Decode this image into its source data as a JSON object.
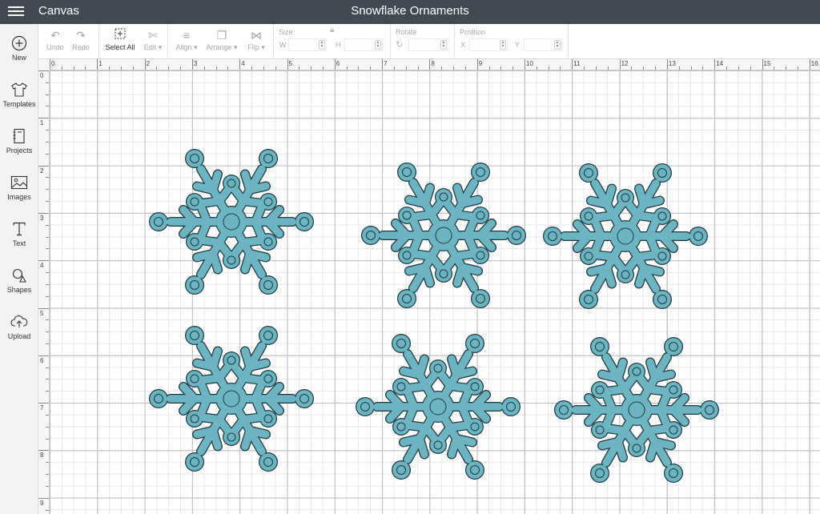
{
  "header": {
    "app_name": "Canvas",
    "project_title": "Snowflake Ornaments"
  },
  "toolbar": {
    "undo": "Undo",
    "redo": "Redo",
    "select_all": "Select All",
    "edit": "Edit",
    "align": "Align",
    "arrange": "Arrange",
    "flip": "Flip",
    "size_label": "Size",
    "w_label": "W",
    "h_label": "H",
    "rotate_label": "Rotate",
    "position_label": "Position",
    "x_label": "X",
    "y_label": "Y"
  },
  "sidebar": {
    "items": [
      {
        "label": "New",
        "icon": "plus-circle-icon"
      },
      {
        "label": "Templates",
        "icon": "tshirt-icon"
      },
      {
        "label": "Projects",
        "icon": "notebook-icon"
      },
      {
        "label": "Images",
        "icon": "image-icon"
      },
      {
        "label": "Text",
        "icon": "text-icon"
      },
      {
        "label": "Shapes",
        "icon": "shapes-icon"
      },
      {
        "label": "Upload",
        "icon": "cloud-upload-icon"
      }
    ]
  },
  "ruler": {
    "top": [
      "0",
      "1",
      "2",
      "3",
      "4",
      "5",
      "6",
      "7",
      "8",
      "9",
      "10",
      "11",
      "12",
      "13",
      "14",
      "15",
      "16"
    ],
    "left": [
      "0",
      "1",
      "2",
      "3",
      "4",
      "5",
      "6",
      "7",
      "8",
      "9"
    ]
  },
  "colors": {
    "snowflake_fill": "#6cb4c2",
    "snowflake_stroke": "#1e3a40",
    "topbar": "#414a52"
  },
  "canvas": {
    "objects": [
      "snowflake-1",
      "snowflake-2",
      "snowflake-3",
      "snowflake-4",
      "snowflake-5",
      "snowflake-6"
    ]
  }
}
